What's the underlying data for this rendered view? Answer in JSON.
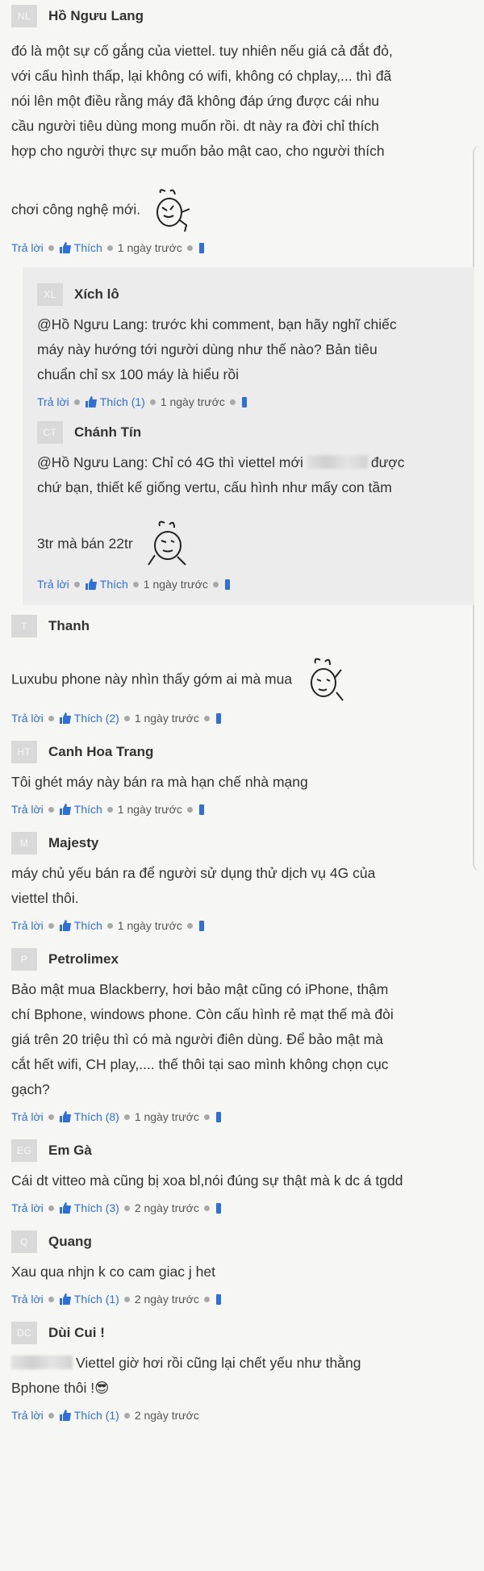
{
  "actions": {
    "reply": "Trả lời",
    "like": "Thích"
  },
  "comments": [
    {
      "avatar": "NL",
      "author": "Hồ Ngưu Lang",
      "lines": [
        "đó là một sự cố gắng của viettel. tuy nhiên nếu giá cả đắt đỏ,",
        "với cấu hình thấp, lại không có wifi, không có chplay,... thì đã",
        "nói lên một điều rằng máy đã không đáp ứng được cái nhu",
        "cầu người tiêu dùng mong muốn rồi. dt này ra đời chỉ thích",
        "hợp cho người thực sự muốn bảo mật cao, cho người thích",
        "chơi công nghệ mới."
      ],
      "sticker": "confused-bunny-sticker",
      "likes": "",
      "time": "1 ngày trước",
      "replies": [
        {
          "avatar": "XL",
          "author": "Xích lô",
          "lines": [
            "@Hồ Ngưu Lang: trước khi comment, bạn hãy nghĩ chiếc",
            "máy này hướng tới người dùng như thế nào? Bản tiêu",
            "chuẩn chỉ sx 100 máy là hiểu rồi"
          ],
          "likes": "(1)",
          "time": "1 ngày trước"
        },
        {
          "avatar": "CT",
          "author": "Chánh Tín",
          "lines": [
            "@Hồ Ngưu Lang: Chỉ có 4G thì viettel mới",
            "được",
            "chứ bạn, thiết kế giống vertu, cấu hình như mấy con tầm",
            "3tr mà bán 22tr"
          ],
          "likes": "",
          "time": "1 ngày trước"
        }
      ]
    },
    {
      "avatar": "T",
      "author": "Thanh",
      "lines": [
        "Luxubu phone này nhìn thấy gớm ai mà mua"
      ],
      "likes": "(2)",
      "time": "1 ngày trước"
    },
    {
      "avatar": "HT",
      "author": "Canh Hoa Trang",
      "lines": [
        "Tôi ghét máy này bán ra mà hạn chế nhà mạng"
      ],
      "likes": "",
      "time": "1 ngày trước"
    },
    {
      "avatar": "M",
      "author": "Majesty",
      "lines": [
        "máy chủ yếu bán ra để người sử dụng thử dịch vụ 4G của",
        "viettel thôi."
      ],
      "likes": "",
      "time": "1 ngày trước"
    },
    {
      "avatar": "P",
      "author": "Petrolimex",
      "lines": [
        "Bảo mật mua Blackberry, hơi bảo mật cũng có iPhone, thậm",
        "chí Bphone, windows phone. Còn cấu hình rẻ mạt thế mà đòi",
        "giá trên 20 triệu thì có mà người điên dùng. Để bảo mật mà",
        "cắt hết wifi, CH play,.... thế thôi tại sao mình không chọn cục",
        "gạch?"
      ],
      "likes": "(8)",
      "time": "1 ngày trước"
    },
    {
      "avatar": "EG",
      "author": "Em Gà",
      "lines": [
        "Cái dt vitteo mà cũng bị xoa bl,nói đúng sự thật mà k dc á tgdd"
      ],
      "likes": "(3)",
      "time": "2 ngày trước"
    },
    {
      "avatar": "Q",
      "author": "Quang",
      "lines": [
        "Xau qua nhjn k co cam giac j het"
      ],
      "likes": "(1)",
      "time": "2 ngày trước"
    },
    {
      "avatar": "DC",
      "author": "Dùi Cui !",
      "lines": [
        "Viettel giờ hơi rồi cũng lại chết yếu như thằng",
        "Bphone thôi !"
      ],
      "emoji": "😎",
      "likes": "(1)",
      "time": "2 ngày trước"
    }
  ],
  "colors": {
    "link": "#2f6fd6",
    "avatar_bg": "#d9d9d9",
    "reply_bg": "#ececec",
    "page_bg": "#f6f6f4"
  }
}
